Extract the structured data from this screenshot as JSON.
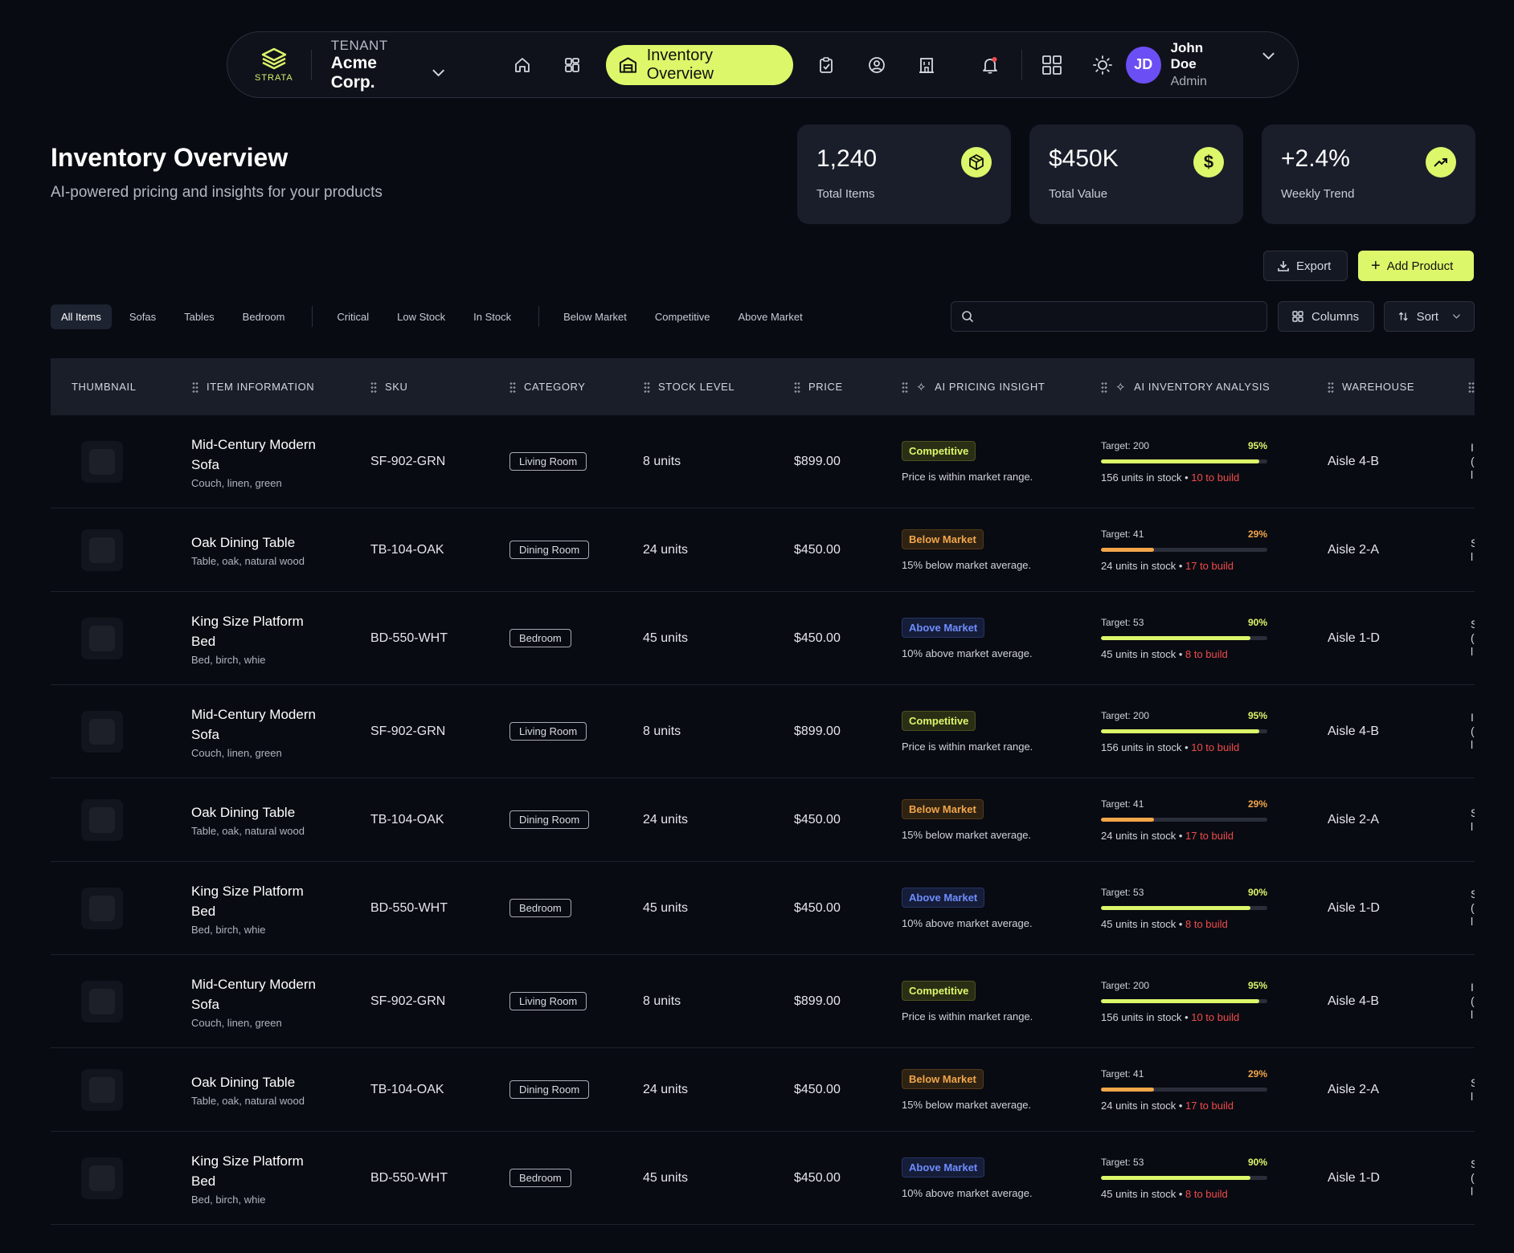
{
  "nav": {
    "logo_text": "STRATA",
    "tenant_label": "TENANT",
    "tenant_name": "Acme Corp.",
    "active_label": "Inventory Overview",
    "user": {
      "initials": "JD",
      "name": "John Doe",
      "role": "Admin"
    }
  },
  "header": {
    "title": "Inventory Overview",
    "subtitle": "AI-powered pricing and insights for your products"
  },
  "stats": [
    {
      "value": "1,240",
      "label": "Total Items",
      "icon": "box-icon"
    },
    {
      "value": "$450K",
      "label": "Total Value",
      "icon": "dollar-icon"
    },
    {
      "value": "+2.4%",
      "label": "Weekly Trend",
      "icon": "trend-up-icon"
    }
  ],
  "actions": {
    "export": "Export",
    "add": "Add Product"
  },
  "filters": {
    "group1": [
      "All Items",
      "Sofas",
      "Tables",
      "Bedroom"
    ],
    "group2": [
      "Critical",
      "Low Stock",
      "In Stock"
    ],
    "group3": [
      "Below Market",
      "Competitive",
      "Above Market"
    ],
    "active": "All Items"
  },
  "search": {
    "placeholder": ""
  },
  "tools": {
    "columns": "Columns",
    "sort": "Sort"
  },
  "columns": [
    "THUMBNAIL",
    "ITEM INFORMATION",
    "SKU",
    "CATEGORY",
    "STOCK LEVEL",
    "PRICE",
    "AI PRICING INSIGHT",
    "AI INVENTORY ANALYSIS",
    "WAREHOUSE"
  ],
  "colors": {
    "accent": "#dcf76a",
    "warn": "#f2a64a",
    "info": "#6f8dff",
    "danger": "#ef4b4b",
    "background": "#090b12"
  },
  "rows": [
    {
      "name": "Mid-Century Modern Sofa",
      "tags": "Couch, linen, green",
      "sku": "SF-902-GRN",
      "category": "Living Room",
      "stock": "8 units",
      "price": "$899.00",
      "insight_badge": "Competitive",
      "insight_kind": "competitive",
      "insight_text": "Price is within market range.",
      "target": "Target: 200",
      "pct": "95%",
      "fill": 0.95,
      "in_stock": "156 units in stock",
      "to_build": "10 to build",
      "warehouse": "Aisle 4-B",
      "edge": [
        "I",
        "(",
        "l"
      ]
    },
    {
      "name": "Oak Dining Table",
      "tags": "Table, oak, natural wood",
      "sku": "TB-104-OAK",
      "category": "Dining Room",
      "stock": "24 units",
      "price": "$450.00",
      "insight_badge": "Below Market",
      "insight_kind": "below",
      "insight_text": "15% below market average.",
      "target": "Target: 41",
      "pct": "29%",
      "fill": 0.32,
      "in_stock": "24 units in stock",
      "to_build": "17 to build",
      "warehouse": "Aisle 2-A",
      "edge": [
        "S",
        "l"
      ]
    },
    {
      "name": "King Size Platform Bed",
      "tags": "Bed, birch, whie",
      "sku": "BD-550-WHT",
      "category": "Bedroom",
      "stock": "45 units",
      "price": "$450.00",
      "insight_badge": "Above Market",
      "insight_kind": "above",
      "insight_text": "10% above market average.",
      "target": "Target: 53",
      "pct": "90%",
      "fill": 0.9,
      "in_stock": "45 units in stock",
      "to_build": "8 to build",
      "warehouse": "Aisle 1-D",
      "edge": [
        "S",
        "(",
        "l"
      ]
    },
    {
      "name": "Mid-Century Modern Sofa",
      "tags": "Couch, linen, green",
      "sku": "SF-902-GRN",
      "category": "Living Room",
      "stock": "8 units",
      "price": "$899.00",
      "insight_badge": "Competitive",
      "insight_kind": "competitive",
      "insight_text": "Price is within market range.",
      "target": "Target: 200",
      "pct": "95%",
      "fill": 0.95,
      "in_stock": "156 units in stock",
      "to_build": "10 to build",
      "warehouse": "Aisle 4-B",
      "edge": [
        "I",
        "(",
        "l"
      ]
    },
    {
      "name": "Oak Dining Table",
      "tags": "Table, oak, natural wood",
      "sku": "TB-104-OAK",
      "category": "Dining Room",
      "stock": "24 units",
      "price": "$450.00",
      "insight_badge": "Below Market",
      "insight_kind": "below",
      "insight_text": "15% below market average.",
      "target": "Target: 41",
      "pct": "29%",
      "fill": 0.32,
      "in_stock": "24 units in stock",
      "to_build": "17 to build",
      "warehouse": "Aisle 2-A",
      "edge": [
        "S",
        "l"
      ]
    },
    {
      "name": "King Size Platform Bed",
      "tags": "Bed, birch, whie",
      "sku": "BD-550-WHT",
      "category": "Bedroom",
      "stock": "45 units",
      "price": "$450.00",
      "insight_badge": "Above Market",
      "insight_kind": "above",
      "insight_text": "10% above market average.",
      "target": "Target: 53",
      "pct": "90%",
      "fill": 0.9,
      "in_stock": "45 units in stock",
      "to_build": "8 to build",
      "warehouse": "Aisle 1-D",
      "edge": [
        "S",
        "(",
        "l"
      ]
    },
    {
      "name": "Mid-Century Modern Sofa",
      "tags": "Couch, linen, green",
      "sku": "SF-902-GRN",
      "category": "Living Room",
      "stock": "8 units",
      "price": "$899.00",
      "insight_badge": "Competitive",
      "insight_kind": "competitive",
      "insight_text": "Price is within market range.",
      "target": "Target: 200",
      "pct": "95%",
      "fill": 0.95,
      "in_stock": "156 units in stock",
      "to_build": "10 to build",
      "warehouse": "Aisle 4-B",
      "edge": [
        "I",
        "(",
        "l"
      ]
    },
    {
      "name": "Oak Dining Table",
      "tags": "Table, oak, natural wood",
      "sku": "TB-104-OAK",
      "category": "Dining Room",
      "stock": "24 units",
      "price": "$450.00",
      "insight_badge": "Below Market",
      "insight_kind": "below",
      "insight_text": "15% below market average.",
      "target": "Target: 41",
      "pct": "29%",
      "fill": 0.32,
      "in_stock": "24 units in stock",
      "to_build": "17 to build",
      "warehouse": "Aisle 2-A",
      "edge": [
        "S",
        "l"
      ]
    },
    {
      "name": "King Size Platform Bed",
      "tags": "Bed, birch, whie",
      "sku": "BD-550-WHT",
      "category": "Bedroom",
      "stock": "45 units",
      "price": "$450.00",
      "insight_badge": "Above Market",
      "insight_kind": "above",
      "insight_text": "10% above market average.",
      "target": "Target: 53",
      "pct": "90%",
      "fill": 0.9,
      "in_stock": "45 units in stock",
      "to_build": "8 to build",
      "warehouse": "Aisle 1-D",
      "edge": [
        "S",
        "(",
        "l"
      ]
    }
  ]
}
